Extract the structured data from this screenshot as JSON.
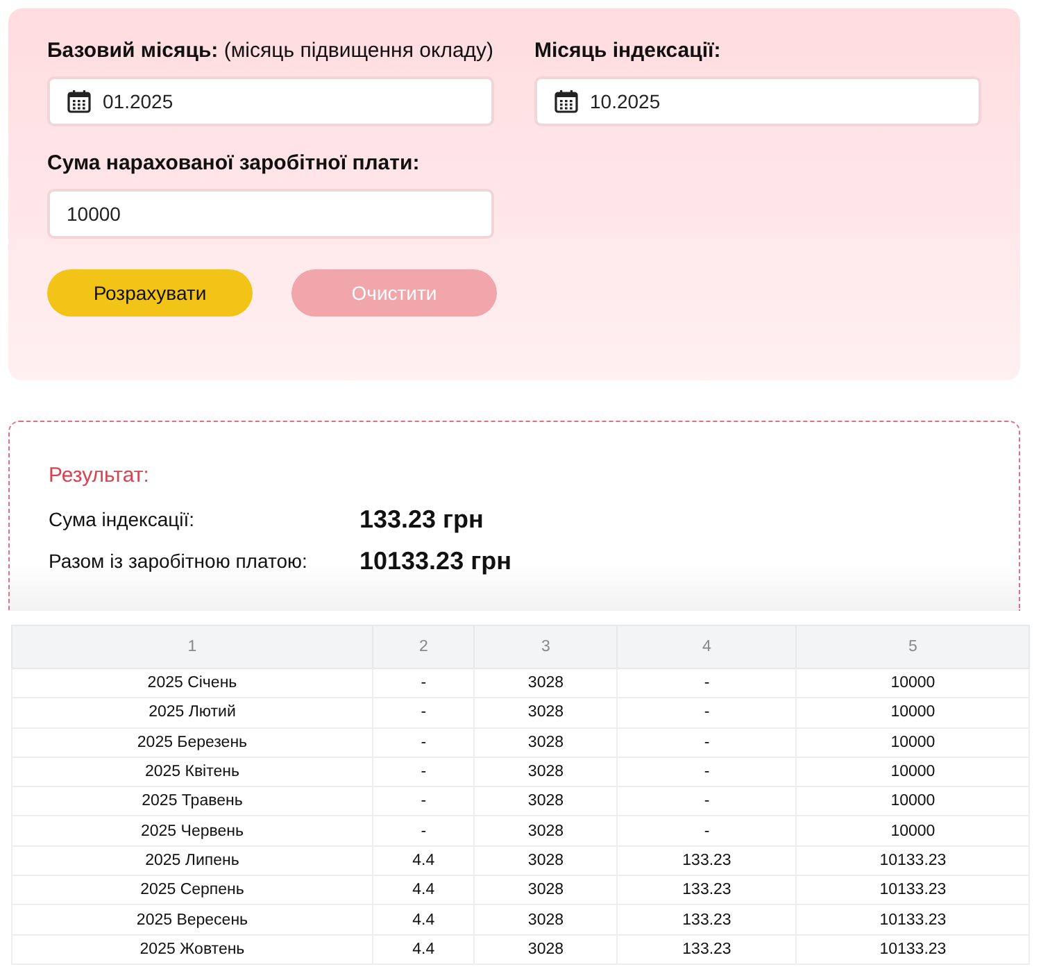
{
  "form": {
    "fields": [
      {
        "kind": "date",
        "label": "**Базовий місяць:** (місяць підвищення окладу)",
        "value": "01.2025"
      },
      {
        "kind": "date",
        "label": "**Місяць індексації:**",
        "value": "10.2025"
      },
      {
        "kind": "text",
        "label": "**Сума нарахованої заробітної плати:**",
        "value": "10000"
      }
    ],
    "buttons": [
      {
        "kind": "primary",
        "label": "Розрахувати",
        "disabled": false
      },
      {
        "kind": "secondary",
        "label": "Очистити",
        "disabled": true
      }
    ]
  },
  "result": {
    "title": "Результат:",
    "rows": [
      {
        "label": "Сума індексації:",
        "value": "133.23 грн"
      },
      {
        "label": "Разом із заробітною платою:",
        "value": "10133.23 грн"
      }
    ]
  },
  "table": {
    "columns": [
      "1",
      "2",
      "3",
      "4",
      "5"
    ],
    "rows": [
      [
        "2025 Січень",
        "-",
        "3028",
        "-",
        "10000"
      ],
      [
        "2025 Лютий",
        "-",
        "3028",
        "-",
        "10000"
      ],
      [
        "2025 Березень",
        "-",
        "3028",
        "-",
        "10000"
      ],
      [
        "2025 Квітень",
        "-",
        "3028",
        "-",
        "10000"
      ],
      [
        "2025 Травень",
        "-",
        "3028",
        "-",
        "10000"
      ],
      [
        "2025 Червень",
        "-",
        "3028",
        "-",
        "10000"
      ],
      [
        "2025 Липень",
        "4.4",
        "3028",
        "133.23",
        "10133.23"
      ],
      [
        "2025 Серпень",
        "4.4",
        "3028",
        "133.23",
        "10133.23"
      ],
      [
        "2025 Вересень",
        "4.4",
        "3028",
        "133.23",
        "10133.23"
      ],
      [
        "2025 Жовтень",
        "4.4",
        "3028",
        "133.23",
        "10133.23"
      ]
    ]
  }
}
